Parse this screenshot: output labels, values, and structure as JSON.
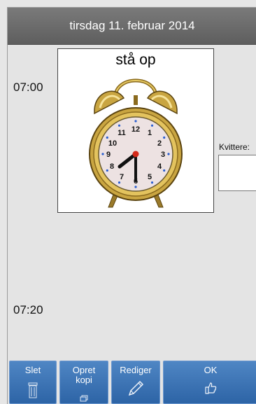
{
  "header": {
    "date": "tirsdag 11. februar 2014"
  },
  "timeline": {
    "time_start": "07:00",
    "time_end": "07:20"
  },
  "activity": {
    "title": "stå op",
    "image": "alarm-clock"
  },
  "confirm": {
    "label": "Kvittere:"
  },
  "toolbar": {
    "delete_label": "Slet",
    "copy_label": "Opret kopi",
    "edit_label": "Rediger",
    "ok_label": "OK"
  },
  "colors": {
    "header_bg": "#6a6a6a",
    "button_bg": "#3c74b6",
    "page_bg": "#e4e4e4"
  },
  "icons": {
    "delete": "trash-icon",
    "copy": "copy-icon",
    "edit": "pencil-icon",
    "ok": "thumbs-up-icon"
  }
}
